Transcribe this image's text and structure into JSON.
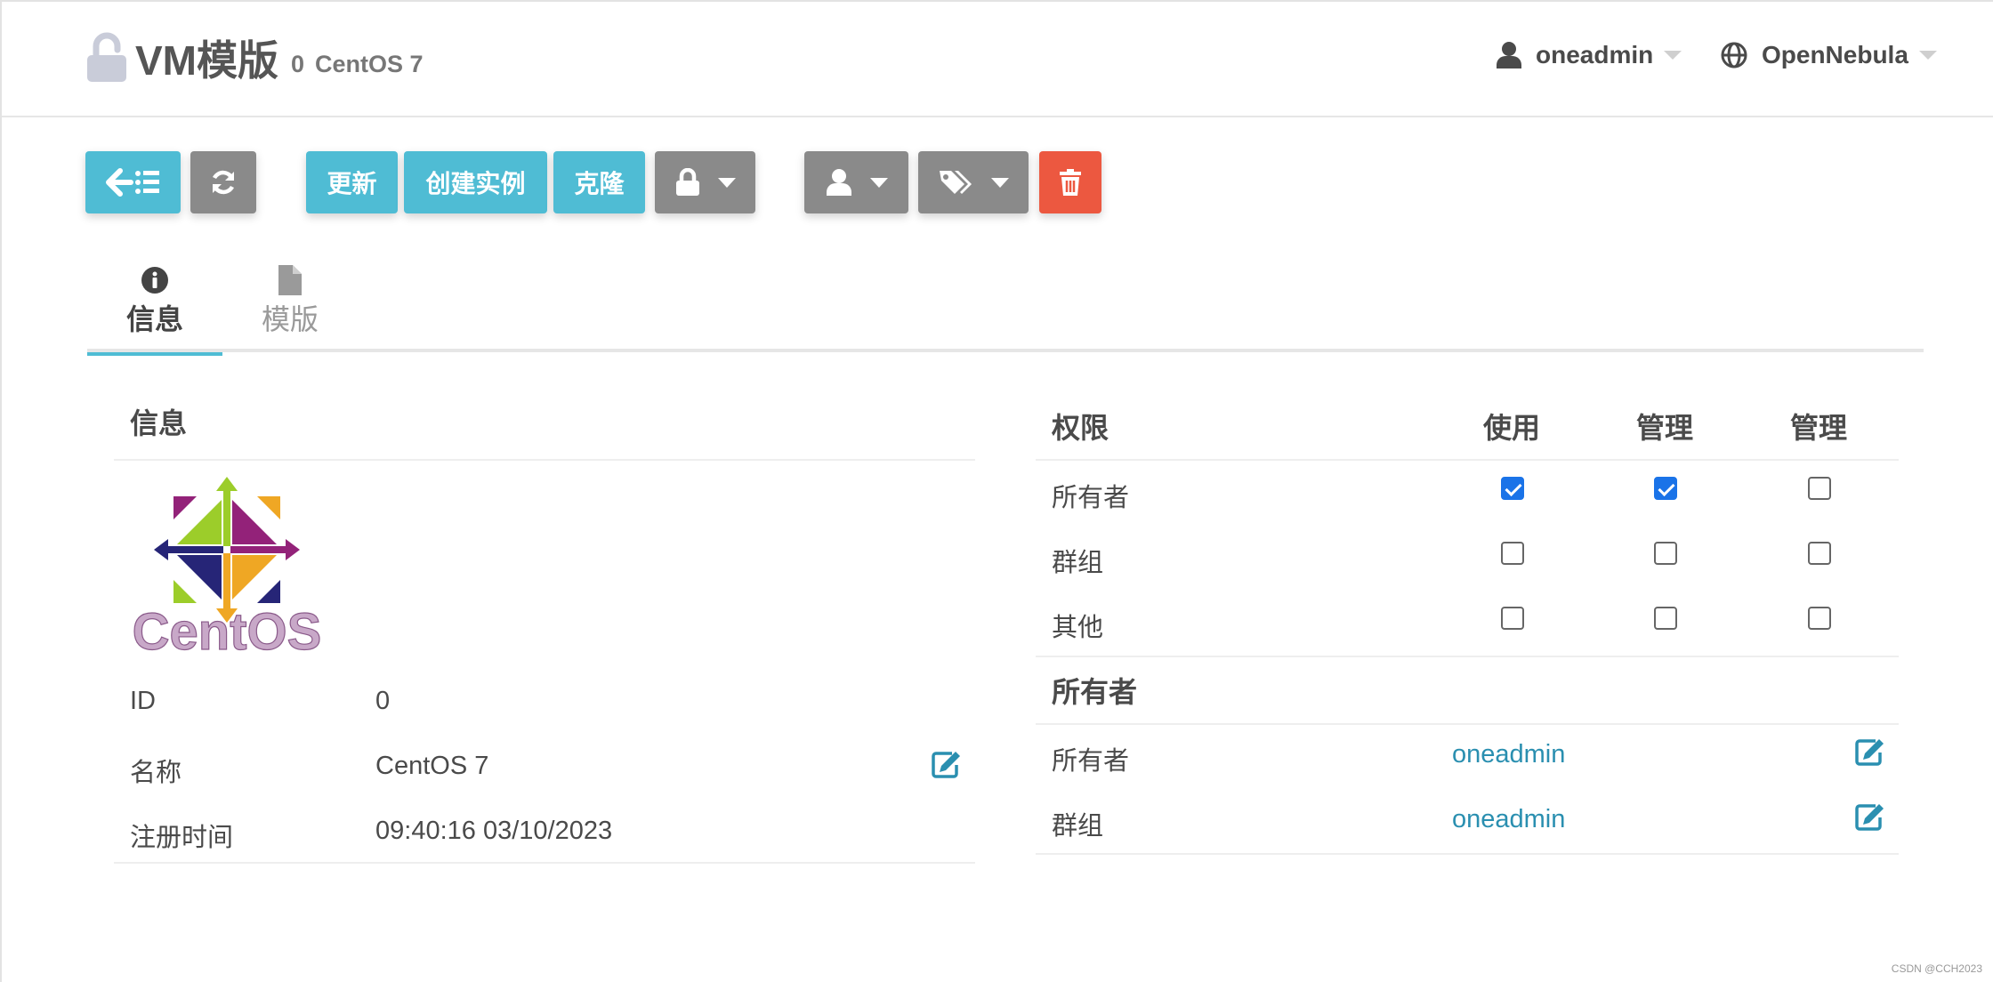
{
  "header": {
    "title": "VM模版",
    "subtitle_id": "0",
    "subtitle_name": "CentOS 7",
    "user_menu": "oneadmin",
    "zone_menu": "OpenNebula",
    "lock_icon": "unlock-icon"
  },
  "toolbar": {
    "update": "更新",
    "create_instance": "创建实例",
    "clone": "克隆",
    "icons": [
      "back-to-list-icon",
      "refresh-icon",
      "lock-icon",
      "user-icon",
      "tags-icon",
      "trash-icon"
    ]
  },
  "tabs": [
    {
      "label": "信息",
      "icon": "info-circle-icon",
      "active": true
    },
    {
      "label": "模版",
      "icon": "file-icon",
      "active": false
    }
  ],
  "info": {
    "title": "信息",
    "logo_text": "CentOS",
    "rows": [
      {
        "label": "ID",
        "value": "0"
      },
      {
        "label": "名称",
        "value": "CentOS 7"
      },
      {
        "label": "注册时间",
        "value": "09:40:16 03/10/2023"
      }
    ]
  },
  "permissions": {
    "title": "权限",
    "columns": [
      "使用",
      "管理",
      "管理"
    ],
    "rows": [
      {
        "label": "所有者",
        "checks": [
          true,
          true,
          false
        ]
      },
      {
        "label": "群组",
        "checks": [
          false,
          false,
          false
        ]
      },
      {
        "label": "其他",
        "checks": [
          false,
          false,
          false
        ]
      }
    ]
  },
  "ownership": {
    "title": "所有者",
    "rows": [
      {
        "label": "所有者",
        "value": "oneadmin"
      },
      {
        "label": "群组",
        "value": "oneadmin"
      }
    ]
  },
  "colors": {
    "info_button": "#4fbcd4",
    "grey_button": "#8a8a8a",
    "danger_button": "#ec5840",
    "link": "#2a8fb0",
    "checkbox_checked": "#1a73e8"
  },
  "watermark": "CSDN @CCH2023"
}
